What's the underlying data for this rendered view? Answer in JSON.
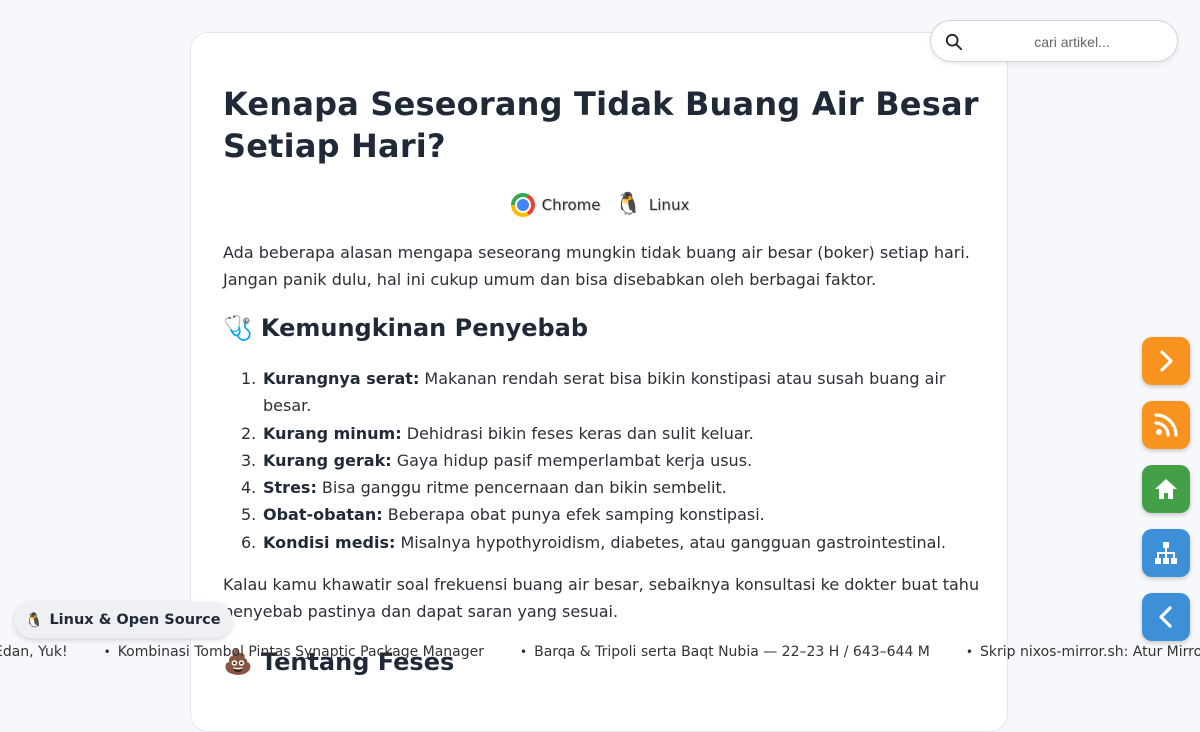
{
  "search": {
    "placeholder": "cari artikel..."
  },
  "article": {
    "title": "Kenapa Seseorang Tidak Buang Air Besar Setiap Hari?",
    "platforms": [
      {
        "name": "Chrome",
        "icon": "chrome-icon"
      },
      {
        "name": "Linux",
        "icon": "tux-icon"
      }
    ],
    "intro": "Ada beberapa alasan mengapa seseorang mungkin tidak buang air besar (boker) setiap hari. Jangan panik dulu, hal ini cukup umum dan bisa disebabkan oleh berbagai faktor.",
    "section1": {
      "emoji": "🩺",
      "heading": "Kemungkinan Penyebab"
    },
    "causes": [
      {
        "num": "1.",
        "term": "Kurangnya serat:",
        "desc": " Makanan rendah serat bisa bikin konstipasi atau susah buang air besar."
      },
      {
        "num": "2.",
        "term": "Kurang minum:",
        "desc": " Dehidrasi bikin feses keras dan sulit keluar."
      },
      {
        "num": "3.",
        "term": "Kurang gerak:",
        "desc": " Gaya hidup pasif memperlambat kerja usus."
      },
      {
        "num": "4.",
        "term": "Stres:",
        "desc": " Bisa ganggu ritme pencernaan dan bikin sembelit."
      },
      {
        "num": "5.",
        "term": "Obat-obatan:",
        "desc": " Beberapa obat punya efek samping konstipasi."
      },
      {
        "num": "6.",
        "term": "Kondisi medis:",
        "desc": " Misalnya hypothyroidism, diabetes, atau gangguan gastrointestinal."
      }
    ],
    "outro": "Kalau kamu khawatir soal frekuensi buang air besar, sebaiknya konsultasi ke dokter buat tahu penyebab pastinya dan dapat saran yang sesuai.",
    "section2": {
      "emoji": "💩",
      "heading": "Tentang Feses"
    }
  },
  "fabs": [
    {
      "name": "next-button",
      "icon": "chevron-right-icon",
      "color": "#f7931e"
    },
    {
      "name": "rss-button",
      "icon": "rss-icon",
      "color": "#f7931e"
    },
    {
      "name": "home-button",
      "icon": "home-icon",
      "color": "#43a047"
    },
    {
      "name": "sitemap-button",
      "icon": "sitemap-icon",
      "color": "#3d8fd8"
    },
    {
      "name": "back-button",
      "icon": "chevron-left-icon",
      "color": "#3d8fd8"
    }
  ],
  "badge": {
    "emoji": "🐧",
    "label": "Linux & Open Source"
  },
  "ticker": [
    "Edan, Yuk!",
    "Kombinasi Tombol Pintas Synaptic Package Manager",
    "Barqa & Tripoli serta Baqt Nubia — 22–23 H / 643–644 M",
    "Skrip nixos-mirror.sh: Atur Mirror Tercepat"
  ]
}
